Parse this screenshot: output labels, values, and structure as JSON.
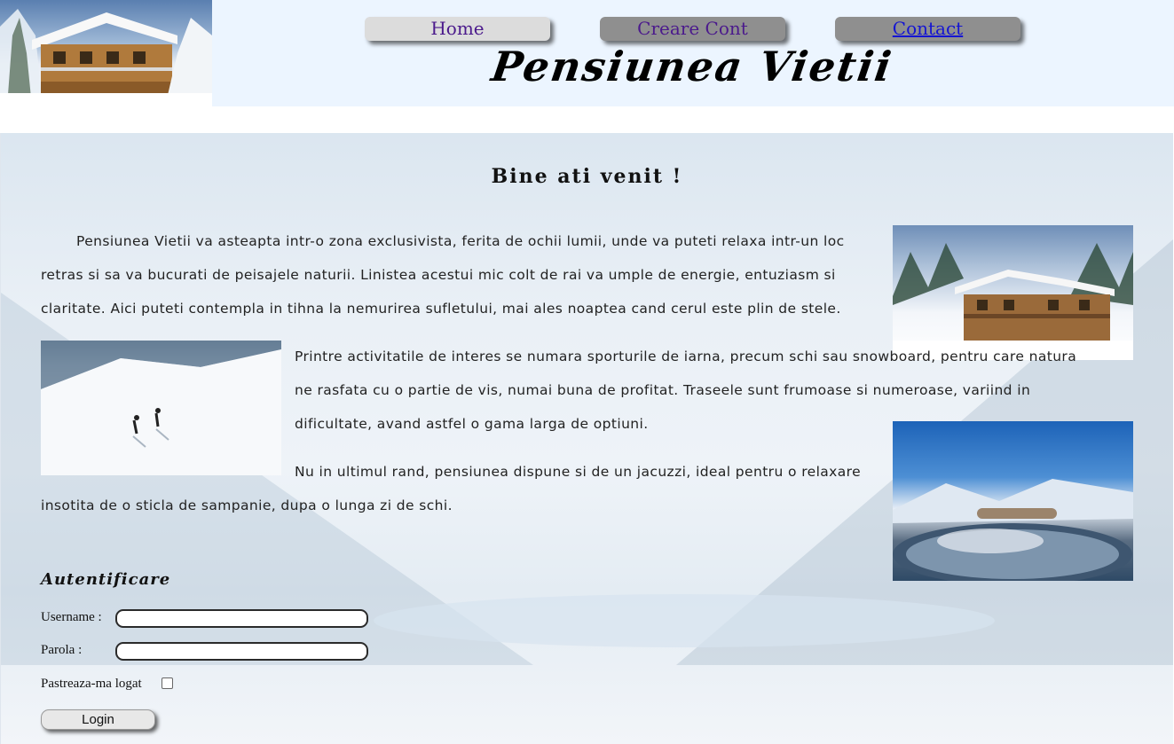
{
  "header": {
    "title": "Pensiunea Vietii",
    "nav": {
      "home": "Home",
      "create_account": "Creare Cont",
      "contact": "Contact"
    }
  },
  "main": {
    "welcome": "Bine ati venit !",
    "paragraphs": {
      "p1": "Pensiunea Vietii va asteapta intr-o zona exclusivista, ferita de ochii lumii, unde va puteti relaxa intr-un loc retras si sa va bucurati de peisajele naturii. Linistea acestui mic colt de rai va umple de energie, entuziasm si claritate. Aici puteti contempla in tihna la nemurirea sufletului, mai ales noaptea cand cerul este plin de stele.",
      "p2": "Printre activitatile de interes se numara sporturile de iarna, precum schi sau snowboard, pentru care natura ne rasfata cu o partie de vis, numai buna de profitat. Traseele sunt frumoase si numeroase, variind in dificultate, avand astfel o gama larga de optiuni.",
      "p3a": "Nu in ultimul rand, pensiunea dispune si de un jacuzzi, ideal pentru o relaxare",
      "p3b": "insotita de o sticla de sampanie, dupa o lunga zi de schi."
    }
  },
  "auth": {
    "title": "Autentificare",
    "username_label": "Username :",
    "password_label": "Parola :",
    "remember_label": "Pastreaza-ma logat",
    "username_value": "",
    "password_value": "",
    "remember_checked": false,
    "login_label": "Login"
  }
}
